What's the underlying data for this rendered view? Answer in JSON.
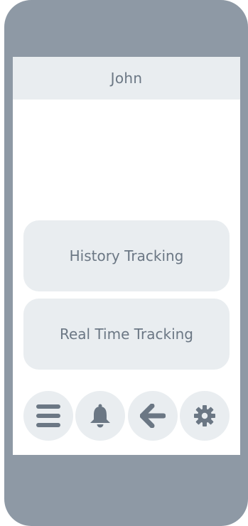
{
  "header": {
    "title": "John"
  },
  "main": {
    "buttons": [
      {
        "label": "History Tracking"
      },
      {
        "label": "Real Time Tracking"
      }
    ]
  },
  "nav": {
    "items": [
      {
        "icon": "menu-icon"
      },
      {
        "icon": "bell-icon"
      },
      {
        "icon": "arrow-left-icon"
      },
      {
        "icon": "gear-icon"
      }
    ]
  },
  "colors": {
    "frame": "#8e99a5",
    "surface": "#e9edf0",
    "icon": "#6b7784",
    "text": "#6b7784"
  }
}
